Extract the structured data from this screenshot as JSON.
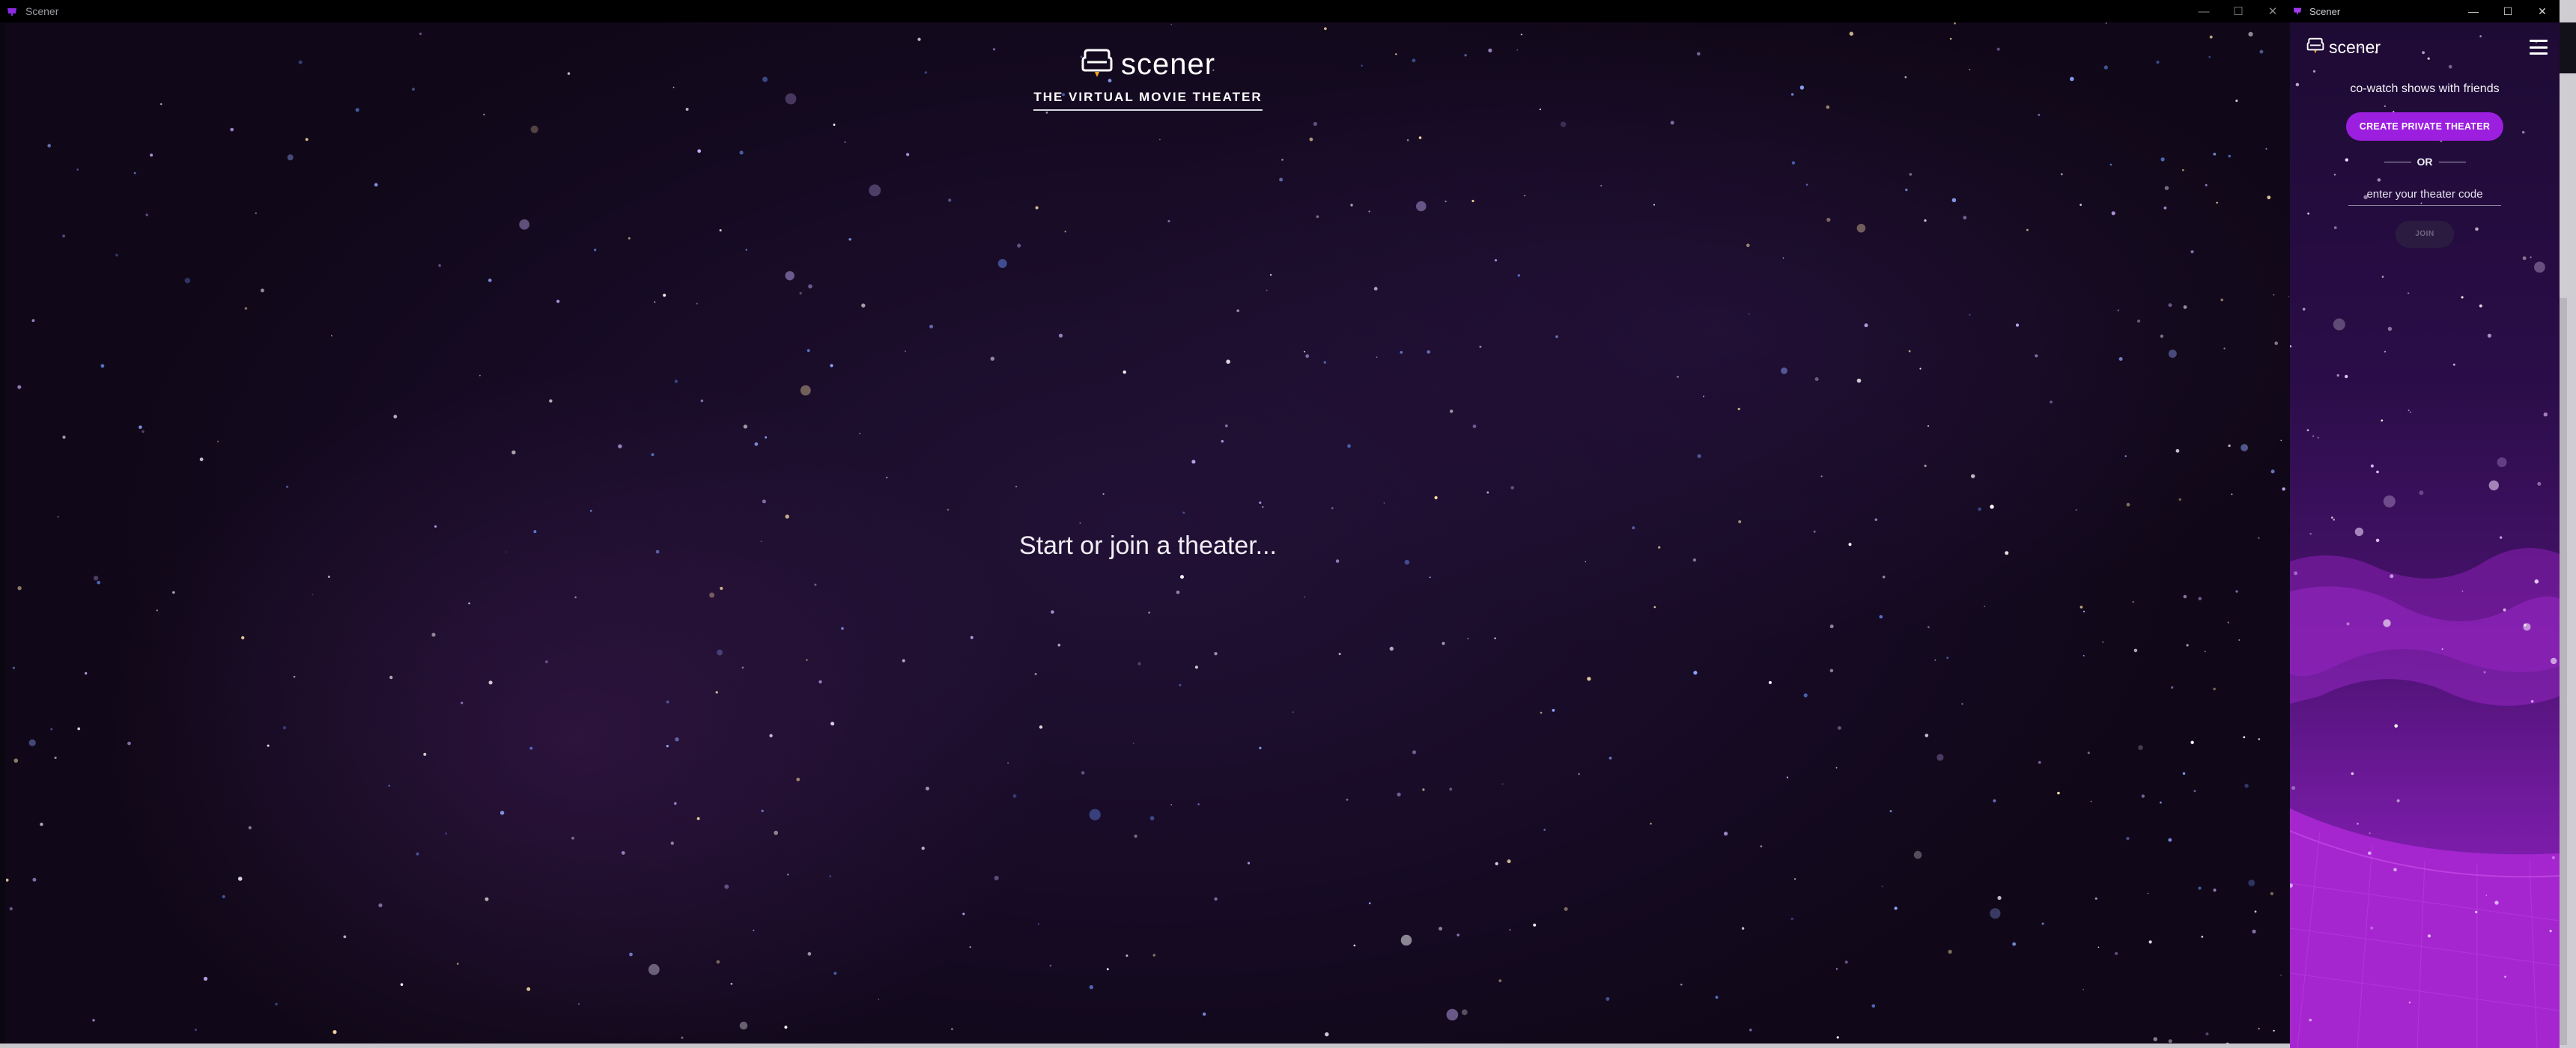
{
  "main_window": {
    "title": "Scener",
    "brand": "scener",
    "tagline": "THE VIRTUAL MOVIE THEATER",
    "center_message": "Start or join a theater...",
    "controls": {
      "minimize": "—",
      "maximize": "☐",
      "close": "✕"
    }
  },
  "side_window": {
    "title": "Scener",
    "brand": "scener",
    "subtitle": "co-watch shows with friends",
    "create_button": "CREATE PRIVATE THEATER",
    "or_text": "OR",
    "code_placeholder": "enter your theater code",
    "join_button": "JOIN",
    "controls": {
      "minimize": "—",
      "maximize": "☐",
      "close": "✕"
    }
  },
  "colors": {
    "accent_purple": "#9c1fe0",
    "background_deep": "#150a22",
    "side_gradient_bottom": "#9c26c9"
  },
  "icons": {
    "app": "scener-logo-icon",
    "menu": "hamburger-menu-icon"
  }
}
